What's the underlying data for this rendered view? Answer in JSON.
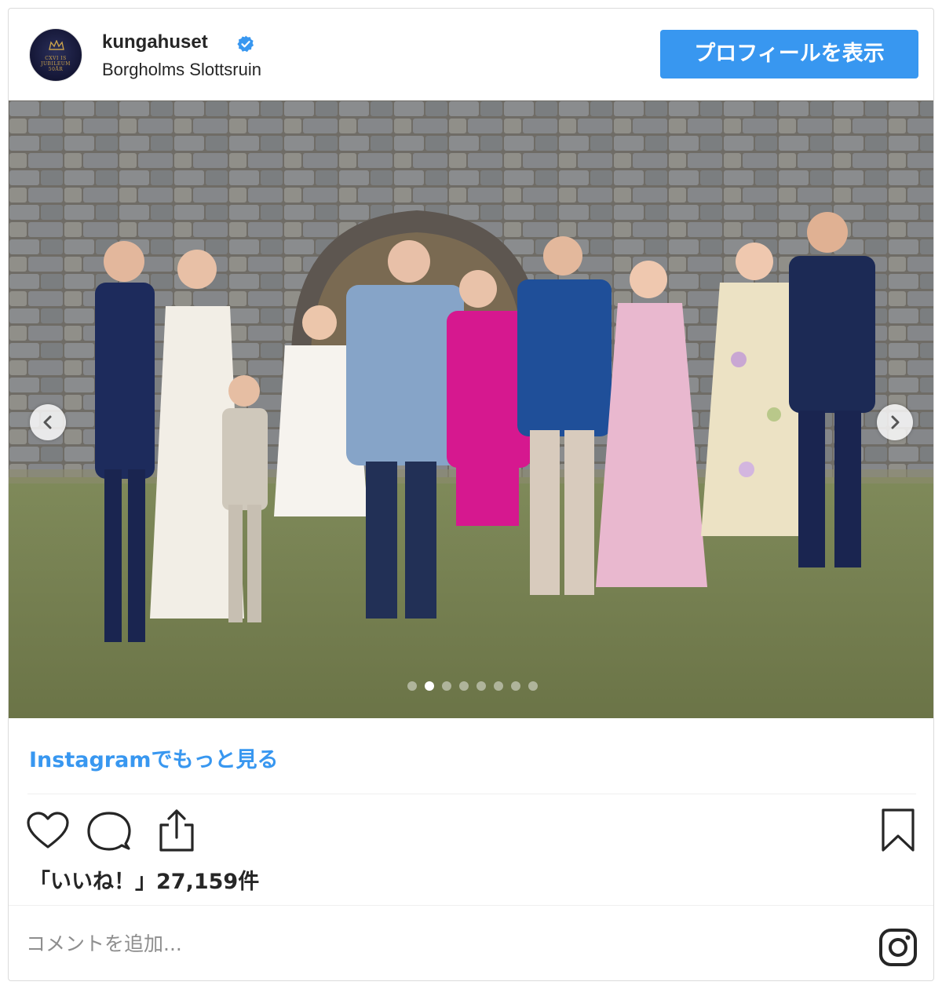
{
  "header": {
    "username": "kungahuset",
    "location": "Borgholms Slottsruin",
    "avatar_text_line1": "CXVI IS",
    "avatar_text_line2": "JUBILEUM",
    "avatar_text_line3": "50ÅR",
    "profile_button_label": "プロフィールを表示",
    "verified_icon": "verified-badge-icon"
  },
  "carousel": {
    "total_slides": 8,
    "active_index": 1,
    "prev_icon": "chevron-left-icon",
    "next_icon": "chevron-right-icon"
  },
  "more_link_label": "Instagramでもっと見る",
  "actions": {
    "like_icon": "heart-icon",
    "comment_icon": "comment-bubble-icon",
    "share_icon": "share-icon",
    "bookmark_icon": "bookmark-icon"
  },
  "likes_text": "「いいね！」27,159件",
  "comment": {
    "placeholder": "コメントを追加...",
    "instagram_icon": "instagram-logo-icon"
  },
  "colors": {
    "accent": "#3897f0",
    "text": "#262626",
    "muted": "#8e8e8e",
    "border": "#dbdbdb"
  }
}
